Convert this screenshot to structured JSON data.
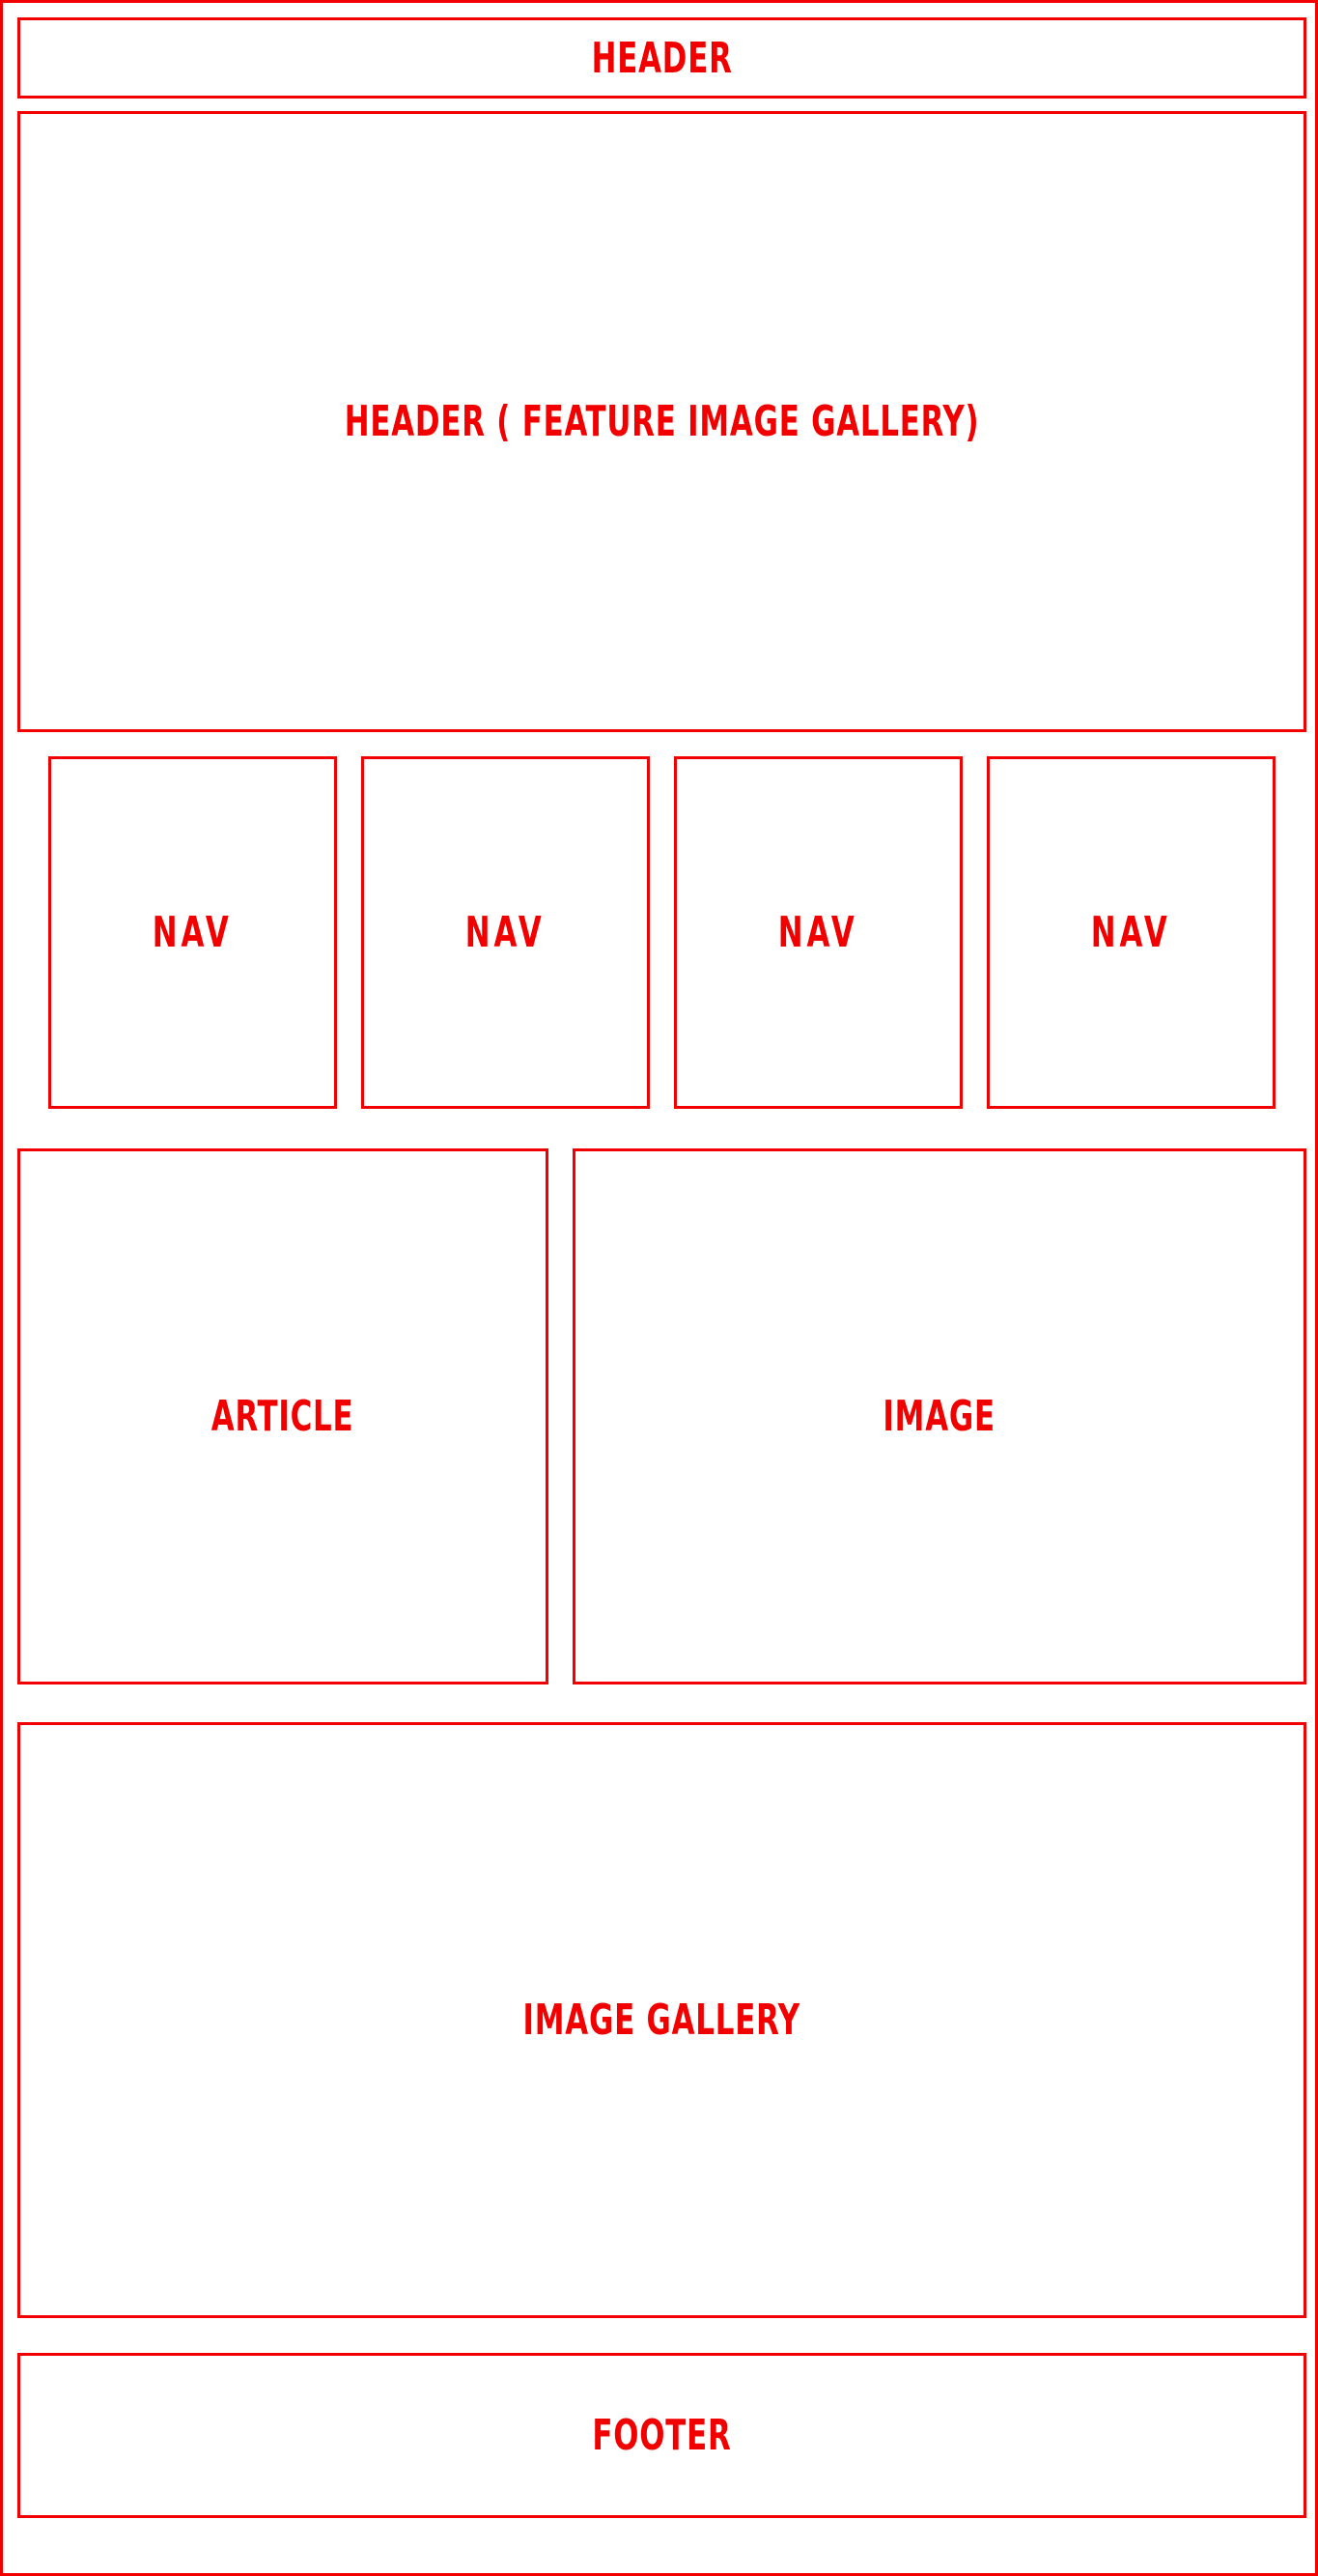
{
  "colors": {
    "stroke": "#f20000",
    "background": "#ffffff"
  },
  "blocks": {
    "header": "HEADER",
    "feature_gallery": "HEADER ( FEATURE IMAGE GALLERY)",
    "nav": [
      "NAV",
      "NAV",
      "NAV",
      "NAV"
    ],
    "article": "ARTICLE",
    "image": "IMAGE",
    "image_gallery": "IMAGE GALLERY",
    "footer": "FOOTER"
  }
}
